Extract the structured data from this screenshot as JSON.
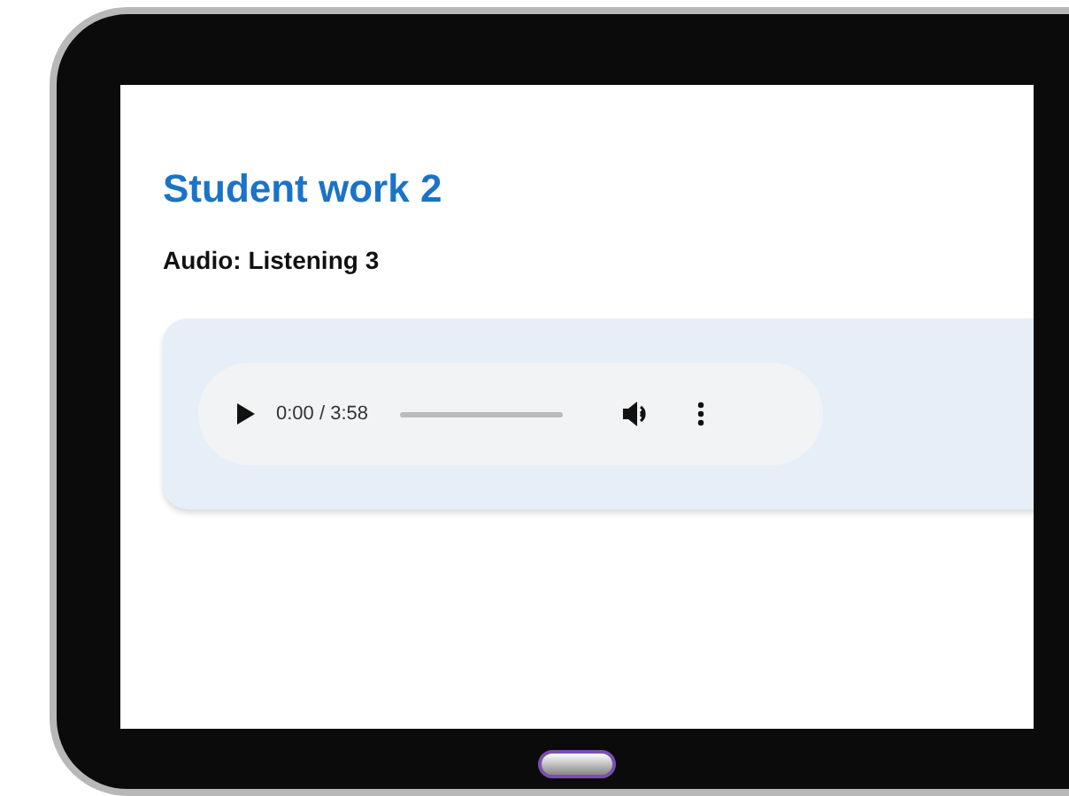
{
  "page": {
    "title": "Student work 2",
    "subtitle": "Audio: Listening 3"
  },
  "audio_player": {
    "time": "0:00 / 3:58",
    "level": 0
  }
}
